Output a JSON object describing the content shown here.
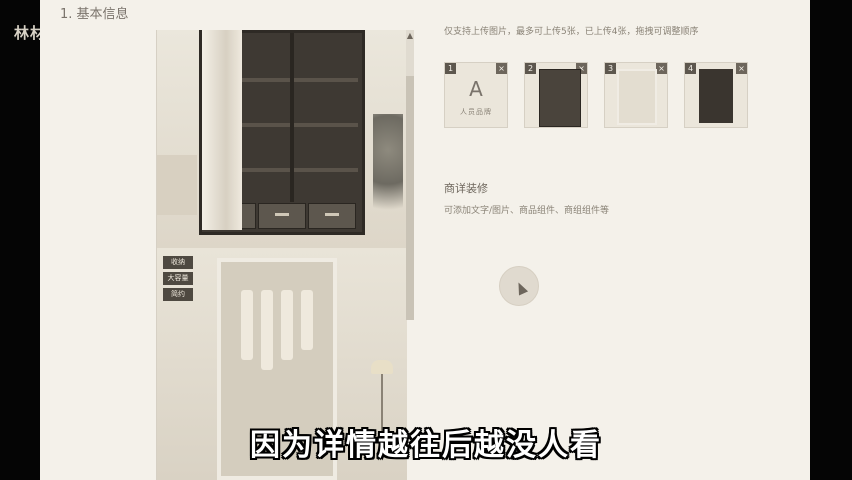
{
  "brand": {
    "text": "林材"
  },
  "section": {
    "title": "1. 基本信息"
  },
  "upload_hint": "仅支持上传图片，最多可上传5张，已上传4张，拖拽可调整顺序",
  "thumbnails": [
    {
      "index": "1",
      "type": "text",
      "glyph": "A",
      "caption": "人员品牌",
      "close": "×"
    },
    {
      "index": "2",
      "type": "image",
      "close": "×"
    },
    {
      "index": "3",
      "type": "image",
      "close": "×"
    },
    {
      "index": "4",
      "type": "image",
      "close": "×"
    }
  ],
  "detail": {
    "title": "商详装修",
    "description": "可添加文字/图片、商品组件、商组组件等"
  },
  "preview_tags": [
    "收纳",
    "大容量",
    "简约"
  ],
  "subtitle": "因为详情越往后越没人看",
  "scroll_up_glyph": "▲",
  "colors": {
    "background": "#f4f1ea",
    "wardrobe": "#3e3933",
    "text": "#6d665c"
  }
}
